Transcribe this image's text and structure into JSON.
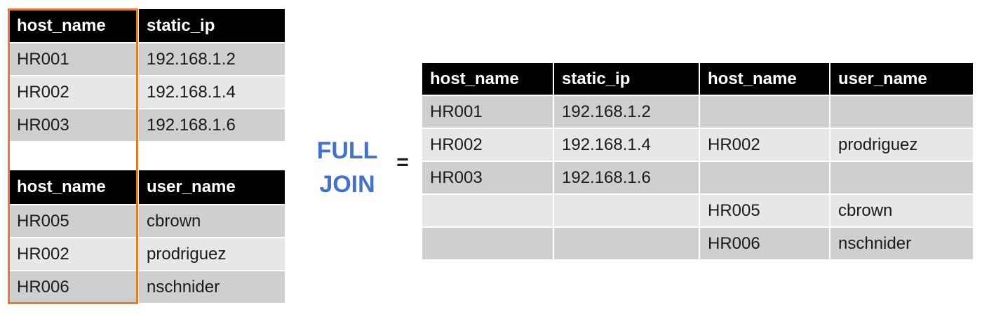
{
  "left_top_table": {
    "headers": [
      "host_name",
      "static_ip"
    ],
    "rows": [
      [
        "HR001",
        "192.168.1.2"
      ],
      [
        "HR002",
        "192.168.1.4"
      ],
      [
        "HR003",
        "192.168.1.6"
      ]
    ]
  },
  "left_bottom_table": {
    "headers": [
      "host_name",
      "user_name"
    ],
    "rows": [
      [
        "HR005",
        "cbrown"
      ],
      [
        "HR002",
        "prodriguez"
      ],
      [
        "HR006",
        "nschnider"
      ]
    ]
  },
  "operation": {
    "label": "FULL\nJOIN",
    "equals": "="
  },
  "result_table": {
    "headers": [
      "host_name",
      "static_ip",
      "host_name",
      "user_name"
    ],
    "rows": [
      [
        "HR001",
        "192.168.1.2",
        "",
        ""
      ],
      [
        "HR002",
        "192.168.1.4",
        "HR002",
        "prodriguez"
      ],
      [
        "HR003",
        "192.168.1.6",
        "",
        ""
      ],
      [
        "",
        "",
        "HR005",
        "cbrown"
      ],
      [
        "",
        "",
        "HR006",
        "nschnider"
      ]
    ]
  },
  "colors": {
    "header_bg": "#000000",
    "row_dark": "#cfcfcf",
    "row_light": "#e7e7e7",
    "key_highlight": "#e47b35",
    "operation_text": "#4472c4"
  }
}
